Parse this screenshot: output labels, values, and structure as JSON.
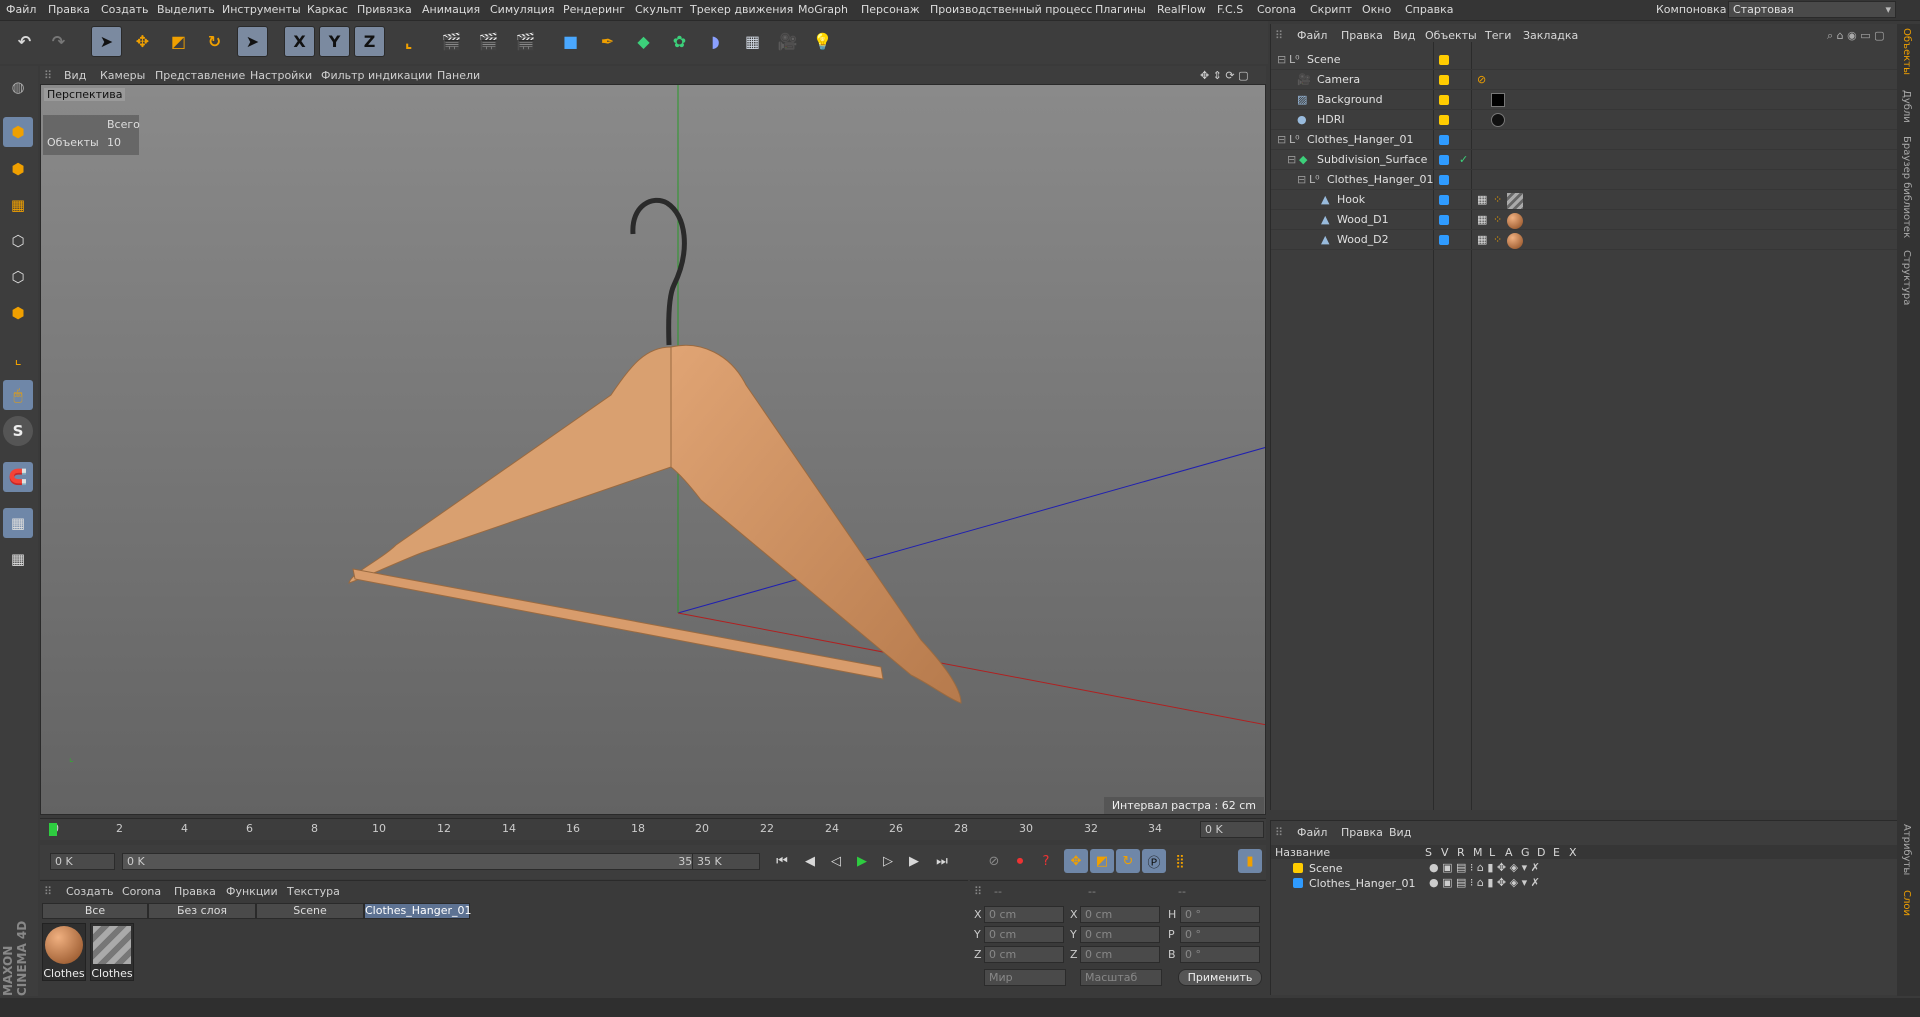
{
  "menu": [
    "Файл",
    "Правка",
    "Создать",
    "Выделить",
    "Инструменты",
    "Каркас",
    "Привязка",
    "Анимация",
    "Симуляция",
    "Рендеринг",
    "Скульпт",
    "Трекер движения",
    "MoGraph",
    "Персонаж",
    "Производственный процесс",
    "Плагины",
    "RealFlow",
    "F.C.S",
    "Corona",
    "Скрипт",
    "Окно",
    "Справка"
  ],
  "layout_label": "Компоновка",
  "layout_value": "Стартовая",
  "toolbar": {
    "x": "X",
    "y": "Y",
    "z": "Z"
  },
  "left_tool_s": "S",
  "viewport": {
    "menu": [
      "Вид",
      "Камеры",
      "Представление",
      "Настройки",
      "Фильтр индикации",
      "Панели"
    ],
    "label": "Перспектива",
    "stats_total": "Всего",
    "stats_objects_label": "Объекты",
    "stats_objects_value": "10",
    "grid_interval": "Интервал растра : 62 cm"
  },
  "timeline": {
    "ticks": [
      "0",
      "2",
      "4",
      "6",
      "8",
      "10",
      "12",
      "14",
      "16",
      "18",
      "20",
      "22",
      "24",
      "26",
      "28",
      "30",
      "32",
      "34"
    ],
    "frame_field": "0 K"
  },
  "transport": {
    "start": "0 K",
    "range_start": "0 K",
    "range_end": "35 K",
    "end": "35 K"
  },
  "material_manager": {
    "menu": [
      "Создать",
      "Corona",
      "Правка",
      "Функции",
      "Текстура"
    ],
    "tabs": [
      "Все",
      "Без слоя",
      "Scene",
      "Clothes_Hanger_01"
    ],
    "materials": [
      "Clothes",
      "Clothes"
    ]
  },
  "coords": {
    "header": [
      "--",
      "--",
      "--"
    ],
    "rows": [
      [
        "X",
        "0 cm",
        "X",
        "0 cm",
        "H",
        "0 °"
      ],
      [
        "Y",
        "0 cm",
        "Y",
        "0 cm",
        "P",
        "0 °"
      ],
      [
        "Z",
        "0 cm",
        "Z",
        "0 cm",
        "B",
        "0 °"
      ]
    ],
    "mode1": "Мир",
    "mode2": "Масштаб",
    "apply": "Применить"
  },
  "object_manager": {
    "menu": [
      "Файл",
      "Правка",
      "Вид",
      "Объекты",
      "Теги",
      "Закладка"
    ],
    "objects": [
      {
        "name": "Scene",
        "indent": 0,
        "color": "#ffcc00"
      },
      {
        "name": "Camera",
        "indent": 2,
        "color": "#ffcc00"
      },
      {
        "name": "Background",
        "indent": 2,
        "color": "#ffcc00"
      },
      {
        "name": "HDRI",
        "indent": 2,
        "color": "#ffcc00"
      },
      {
        "name": "Clothes_Hanger_01",
        "indent": 0,
        "color": "#2f9bff"
      },
      {
        "name": "Subdivision_Surface",
        "indent": 1,
        "color": "#2f9bff"
      },
      {
        "name": "Clothes_Hanger_01",
        "indent": 2,
        "color": "#2f9bff"
      },
      {
        "name": "Hook",
        "indent": 3,
        "color": "#2f9bff"
      },
      {
        "name": "Wood_D1",
        "indent": 3,
        "color": "#2f9bff"
      },
      {
        "name": "Wood_D2",
        "indent": 3,
        "color": "#2f9bff"
      }
    ]
  },
  "layer_manager": {
    "menu": [
      "Файл",
      "Правка",
      "Вид"
    ],
    "header_name": "Название",
    "columns": [
      "S",
      "V",
      "R",
      "M",
      "L",
      "A",
      "G",
      "D",
      "E",
      "X"
    ],
    "layers": [
      {
        "name": "Scene",
        "color": "#ffcc00"
      },
      {
        "name": "Clothes_Hanger_01",
        "color": "#2f9bff"
      }
    ]
  },
  "right_tabs": [
    "Объекты",
    "Дубли",
    "Браузер библиотек",
    "Структура",
    "Атрибуты",
    "Слои"
  ],
  "brand": "MAXON CINEMA 4D"
}
